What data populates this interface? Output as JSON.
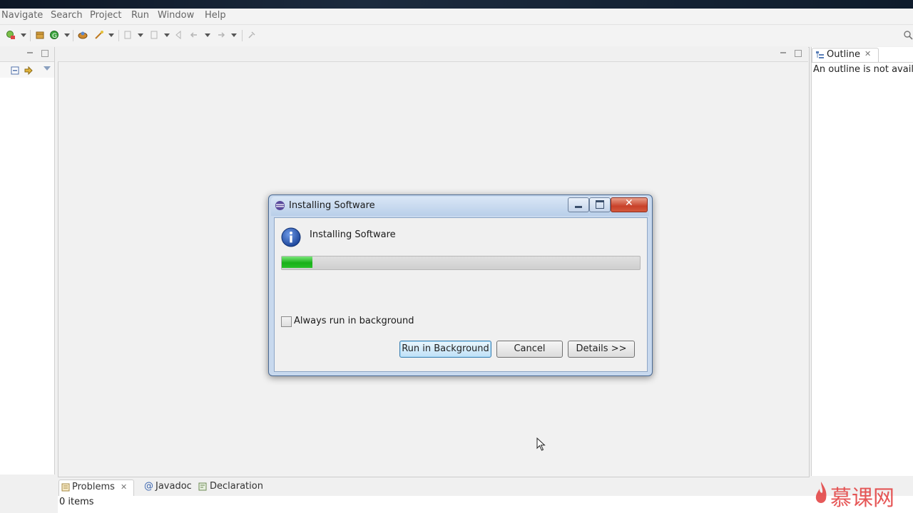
{
  "menu": {
    "items": [
      "Navigate",
      "Search",
      "Project",
      "Run",
      "Window",
      "Help"
    ]
  },
  "outline": {
    "tab_label": "Outline",
    "message": "An outline is not availa"
  },
  "bottom_panel": {
    "tabs": [
      "Problems",
      "Javadoc",
      "Declaration"
    ],
    "status": "0 items"
  },
  "dialog": {
    "window_title": "Installing Software",
    "heading": "Installing Software",
    "progress": 0.085,
    "checkbox_label": "Always run in background",
    "checkbox_checked": false,
    "buttons": {
      "run_background": "Run in Background",
      "cancel": "Cancel",
      "details": "Details >>"
    }
  },
  "watermark": {
    "text": "慕课网"
  },
  "colors": {
    "progress_green": "#19b019",
    "info_blue": "#1d4fa8",
    "close_red": "#c8412a",
    "watermark": "#e23c3c"
  }
}
